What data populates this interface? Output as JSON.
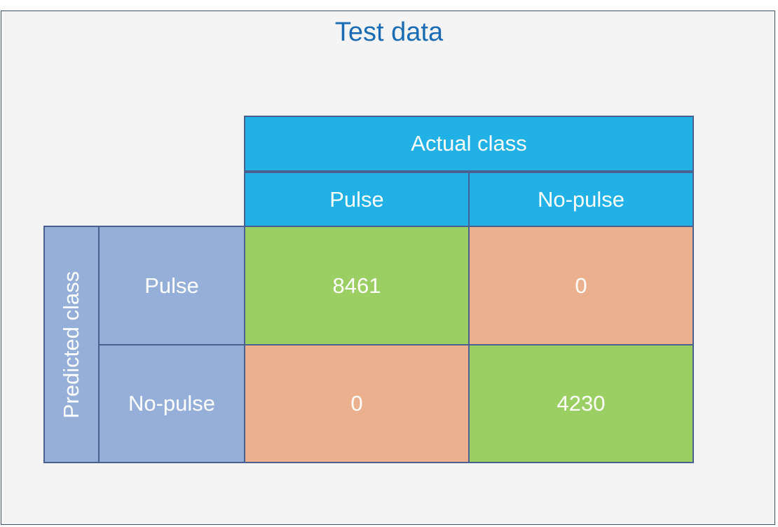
{
  "title": "Test data",
  "matrix": {
    "actual_header": "Actual class",
    "predicted_header": "Predicted class",
    "columns": [
      "Pulse",
      "No-pulse"
    ],
    "rows": [
      "Pulse",
      "No-pulse"
    ],
    "values": [
      [
        "8461",
        "0"
      ],
      [
        "0",
        "4230"
      ]
    ]
  },
  "colors": {
    "header_blue": "#21b1e6",
    "row_header_lavender": "#95afd8",
    "correct_green": "#9bcf63",
    "error_peach": "#ebb18f",
    "title_blue": "#1a6cb4"
  }
}
